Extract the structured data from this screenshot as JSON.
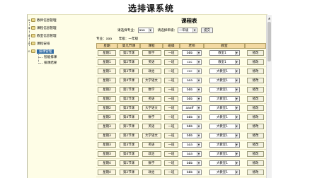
{
  "system_title": "选排课系统",
  "page_title": "课程表",
  "sidebar": {
    "items": [
      {
        "label": "教师信息管理"
      },
      {
        "label": "课程信息管理"
      },
      {
        "label": "教室信息管理"
      },
      {
        "label": "课程安排"
      },
      {
        "label": "排课管理"
      }
    ],
    "children": [
      {
        "label": "智能排课"
      },
      {
        "label": "排课结果"
      }
    ]
  },
  "filter": {
    "major_label": "请选择专业：",
    "major_value": "aaa",
    "grade_label": "请选择年级：",
    "grade_value": "一年级",
    "submit_label": "提交"
  },
  "info": {
    "major": "专业：aaa",
    "grade": "年级：一年级"
  },
  "table": {
    "headers": [
      "星期",
      "第几节课",
      "课程",
      "班级",
      "老师",
      "教室",
      ""
    ],
    "rows": [
      {
        "day": "星期1",
        "period": "第1节课",
        "course": "数学",
        "class": "一班",
        "teacher": "bbb",
        "room": "教室1",
        "action": "修改"
      },
      {
        "day": "星期1",
        "period": "第2节课",
        "course": "英语",
        "class": "一班",
        "teacher": "ccc",
        "room": "教室1",
        "action": "修改"
      },
      {
        "day": "星期1",
        "period": "第3节课",
        "course": "政治",
        "class": "一班",
        "teacher": "ccc",
        "room": "大教室1",
        "action": "修改"
      },
      {
        "day": "星期1",
        "period": "第4节课",
        "course": "大学语文",
        "class": "一班",
        "teacher": "aaa",
        "room": "大教室1",
        "action": "修改"
      },
      {
        "day": "星期2",
        "period": "第1节课",
        "course": "数学",
        "class": "一班",
        "teacher": "bbb",
        "room": "大教室1",
        "action": "修改"
      },
      {
        "day": "星期2",
        "period": "第2节课",
        "course": "英语",
        "class": "一班",
        "teacher": "bbb",
        "room": "大教室1",
        "action": "修改"
      },
      {
        "day": "星期2",
        "period": "第3节课",
        "course": "大学语文",
        "class": "一班",
        "teacher": "aaaff",
        "room": "大教室1",
        "action": "修改"
      },
      {
        "day": "星期2",
        "period": "第4节课",
        "course": "数学",
        "class": "一班",
        "teacher": "bbb",
        "room": "大教室1",
        "action": "修改"
      },
      {
        "day": "星期3",
        "period": "第1节课",
        "course": "英语",
        "class": "一班",
        "teacher": "bbb",
        "room": "大教室1",
        "action": "修改"
      },
      {
        "day": "星期3",
        "period": "第2节课",
        "course": "大学语文",
        "class": "一班",
        "teacher": "bbb",
        "room": "大教室1",
        "action": "修改"
      },
      {
        "day": "星期3",
        "period": "第3节课",
        "course": "英语",
        "class": "一班",
        "teacher": "aaa",
        "room": "大教室1",
        "action": "修改"
      },
      {
        "day": "星期3",
        "period": "第4节课",
        "course": "政治",
        "class": "一班",
        "teacher": "aaa",
        "room": "大教室1",
        "action": "修改"
      },
      {
        "day": "星期4",
        "period": "第1节课",
        "course": "数学",
        "class": "一班",
        "teacher": "bbb",
        "room": "大教室1",
        "action": "修改"
      },
      {
        "day": "星期4",
        "period": "第2节课",
        "course": "政治",
        "class": "一班",
        "teacher": "bbb",
        "room": "大教室1",
        "action": "修改"
      }
    ]
  },
  "colors": {
    "page_bg": "#fefde6",
    "header_bg": "#f2d9a2",
    "selection": "#2f6aa3"
  }
}
